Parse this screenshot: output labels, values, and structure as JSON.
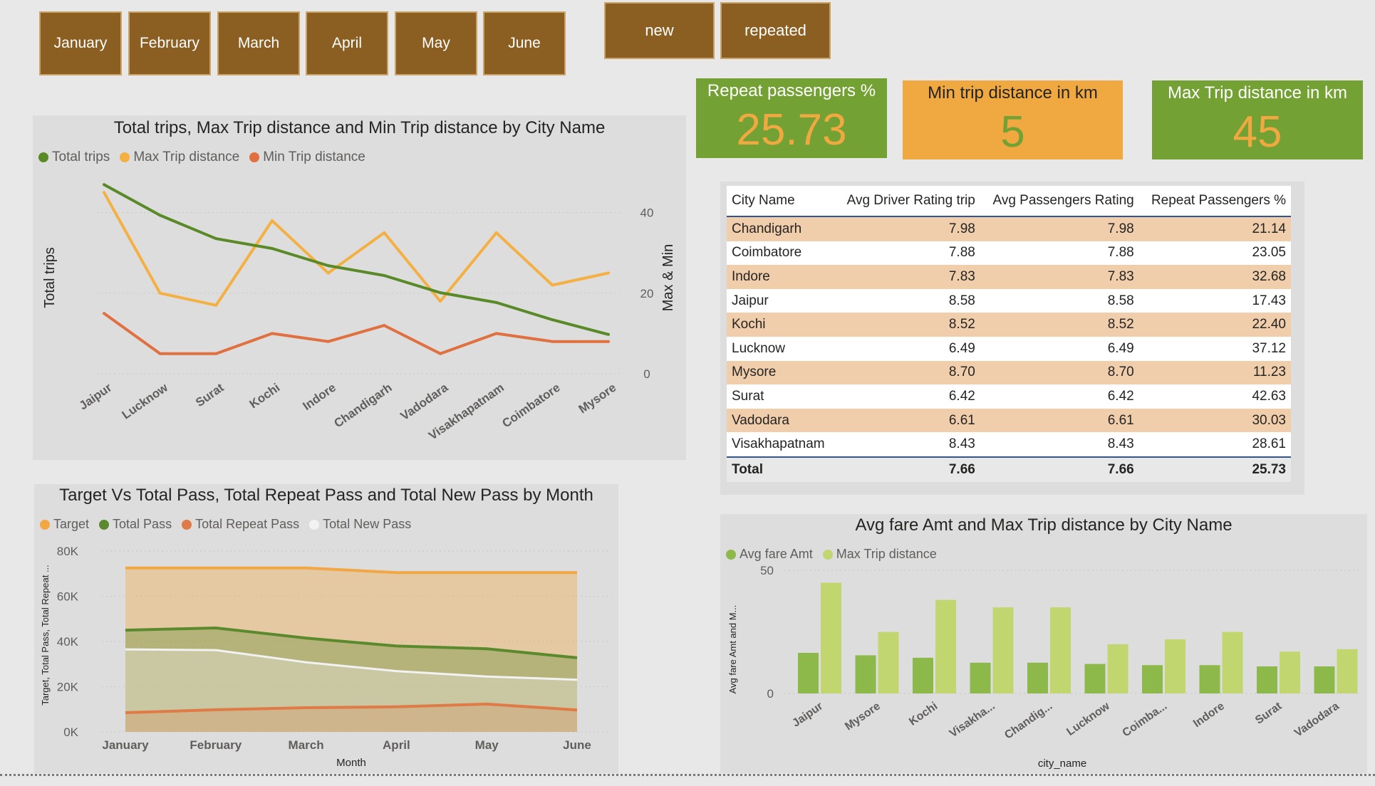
{
  "slicers": {
    "months": [
      "January",
      "February",
      "March",
      "April",
      "May",
      "June"
    ],
    "passenger_types": [
      "new",
      "repeated"
    ]
  },
  "cards": {
    "repeat": {
      "label": "Repeat passengers %",
      "value": "25.73"
    },
    "min_dist": {
      "label": "Min trip distance in km",
      "value": "5"
    },
    "max_dist": {
      "label": "Max Trip distance in km",
      "value": "45"
    }
  },
  "colors": {
    "slicer_bg": "#8b5e22",
    "green_card": "#73a133",
    "orange_card": "#f0a840",
    "card_value_on_green": "#f0a840",
    "card_value_on_orange": "#73a133",
    "total_trips": "#5a8a28",
    "max_trip": "#f4b042",
    "min_trip": "#e07040",
    "target": "#f2a744",
    "total_pass": "#5b8a2e",
    "repeat_pass": "#e07a46",
    "new_pass": "#f2f2f2",
    "avg_fare": "#8db84a",
    "max_trip_bar": "#c2d670",
    "table_band": "#f0ceac"
  },
  "chart_data": [
    {
      "type": "line",
      "title": "Total trips, Max Trip distance and Min Trip distance by City Name",
      "categories": [
        "Jaipur",
        "Lucknow",
        "Surat",
        "Kochi",
        "Indore",
        "Chandigarh",
        "Vadodara",
        "Visakhapatnam",
        "Coimbatore",
        "Mysore"
      ],
      "ylabel": "Total trips",
      "y2label": "Max & Min",
      "y2ticks": [
        "0",
        "20",
        "40"
      ],
      "y2lim": [
        0,
        50
      ],
      "series": [
        {
          "name": "Total trips",
          "axis": "left",
          "values": [
            77000,
            64500,
            55000,
            51000,
            44000,
            40000,
            33000,
            29000,
            22000,
            16000
          ]
        },
        {
          "name": "Max Trip distance",
          "axis": "right",
          "values": [
            45,
            20,
            17,
            38,
            25,
            35,
            18,
            35,
            22,
            25
          ]
        },
        {
          "name": "Min Trip distance",
          "axis": "right",
          "values": [
            15,
            5,
            5,
            10,
            8,
            12,
            5,
            10,
            8,
            8
          ]
        }
      ],
      "ylim": [
        0,
        82000
      ],
      "legend": "top-left"
    },
    {
      "type": "area",
      "title": "Target Vs Total Pass, Total Repeat Pass and Total New Pass by Month",
      "categories": [
        "January",
        "February",
        "March",
        "April",
        "May",
        "June"
      ],
      "xlabel": "Month",
      "ylabel": "Target, Total Pass, Total Repeat ...",
      "yticks": [
        "0K",
        "20K",
        "40K",
        "60K",
        "80K"
      ],
      "ylim": [
        0,
        80000
      ],
      "series": [
        {
          "name": "Target",
          "values": [
            72500,
            72500,
            72500,
            70500,
            70500,
            70500
          ]
        },
        {
          "name": "Total Pass",
          "values": [
            45000,
            46000,
            41500,
            38000,
            36800,
            32800
          ]
        },
        {
          "name": "Total Repeat Pass",
          "values": [
            8500,
            9800,
            10700,
            11100,
            12300,
            9700
          ]
        },
        {
          "name": "Total New Pass",
          "values": [
            36500,
            36200,
            30800,
            26900,
            24500,
            23100
          ]
        }
      ],
      "legend": "top-left"
    },
    {
      "type": "bar",
      "title": "Avg fare Amt and Max Trip distance by City Name",
      "categories": [
        "Jaipur",
        "Mysore",
        "Kochi",
        "Visakha...",
        "Chandig...",
        "Lucknow",
        "Coimba...",
        "Indore",
        "Surat",
        "Vadodara"
      ],
      "xlabel": "city_name",
      "ylabel": "Avg fare Amt and M...",
      "yticks": [
        "0",
        "50"
      ],
      "ylim": [
        0,
        57
      ],
      "series": [
        {
          "name": "Avg fare Amt",
          "values": [
            16.5,
            15.5,
            14.5,
            12.5,
            12.5,
            12,
            11.5,
            11.5,
            11,
            11
          ]
        },
        {
          "name": "Max Trip distance",
          "values": [
            45,
            25,
            38,
            35,
            35,
            20,
            22,
            25,
            17,
            18
          ]
        }
      ],
      "legend": "top-left"
    },
    {
      "type": "table",
      "columns": [
        "City Name",
        "Avg Driver Rating trip",
        "Avg Passengers Rating",
        "Repeat Passengers %"
      ],
      "rows": [
        [
          "Chandigarh",
          "7.98",
          "7.98",
          "21.14"
        ],
        [
          "Coimbatore",
          "7.88",
          "7.88",
          "23.05"
        ],
        [
          "Indore",
          "7.83",
          "7.83",
          "32.68"
        ],
        [
          "Jaipur",
          "8.58",
          "8.58",
          "17.43"
        ],
        [
          "Kochi",
          "8.52",
          "8.52",
          "22.40"
        ],
        [
          "Lucknow",
          "6.49",
          "6.49",
          "37.12"
        ],
        [
          "Mysore",
          "8.70",
          "8.70",
          "11.23"
        ],
        [
          "Surat",
          "6.42",
          "6.42",
          "42.63"
        ],
        [
          "Vadodara",
          "6.61",
          "6.61",
          "30.03"
        ],
        [
          "Visakhapatnam",
          "8.43",
          "8.43",
          "28.61"
        ]
      ],
      "total": [
        "Total",
        "7.66",
        "7.66",
        "25.73"
      ]
    }
  ]
}
